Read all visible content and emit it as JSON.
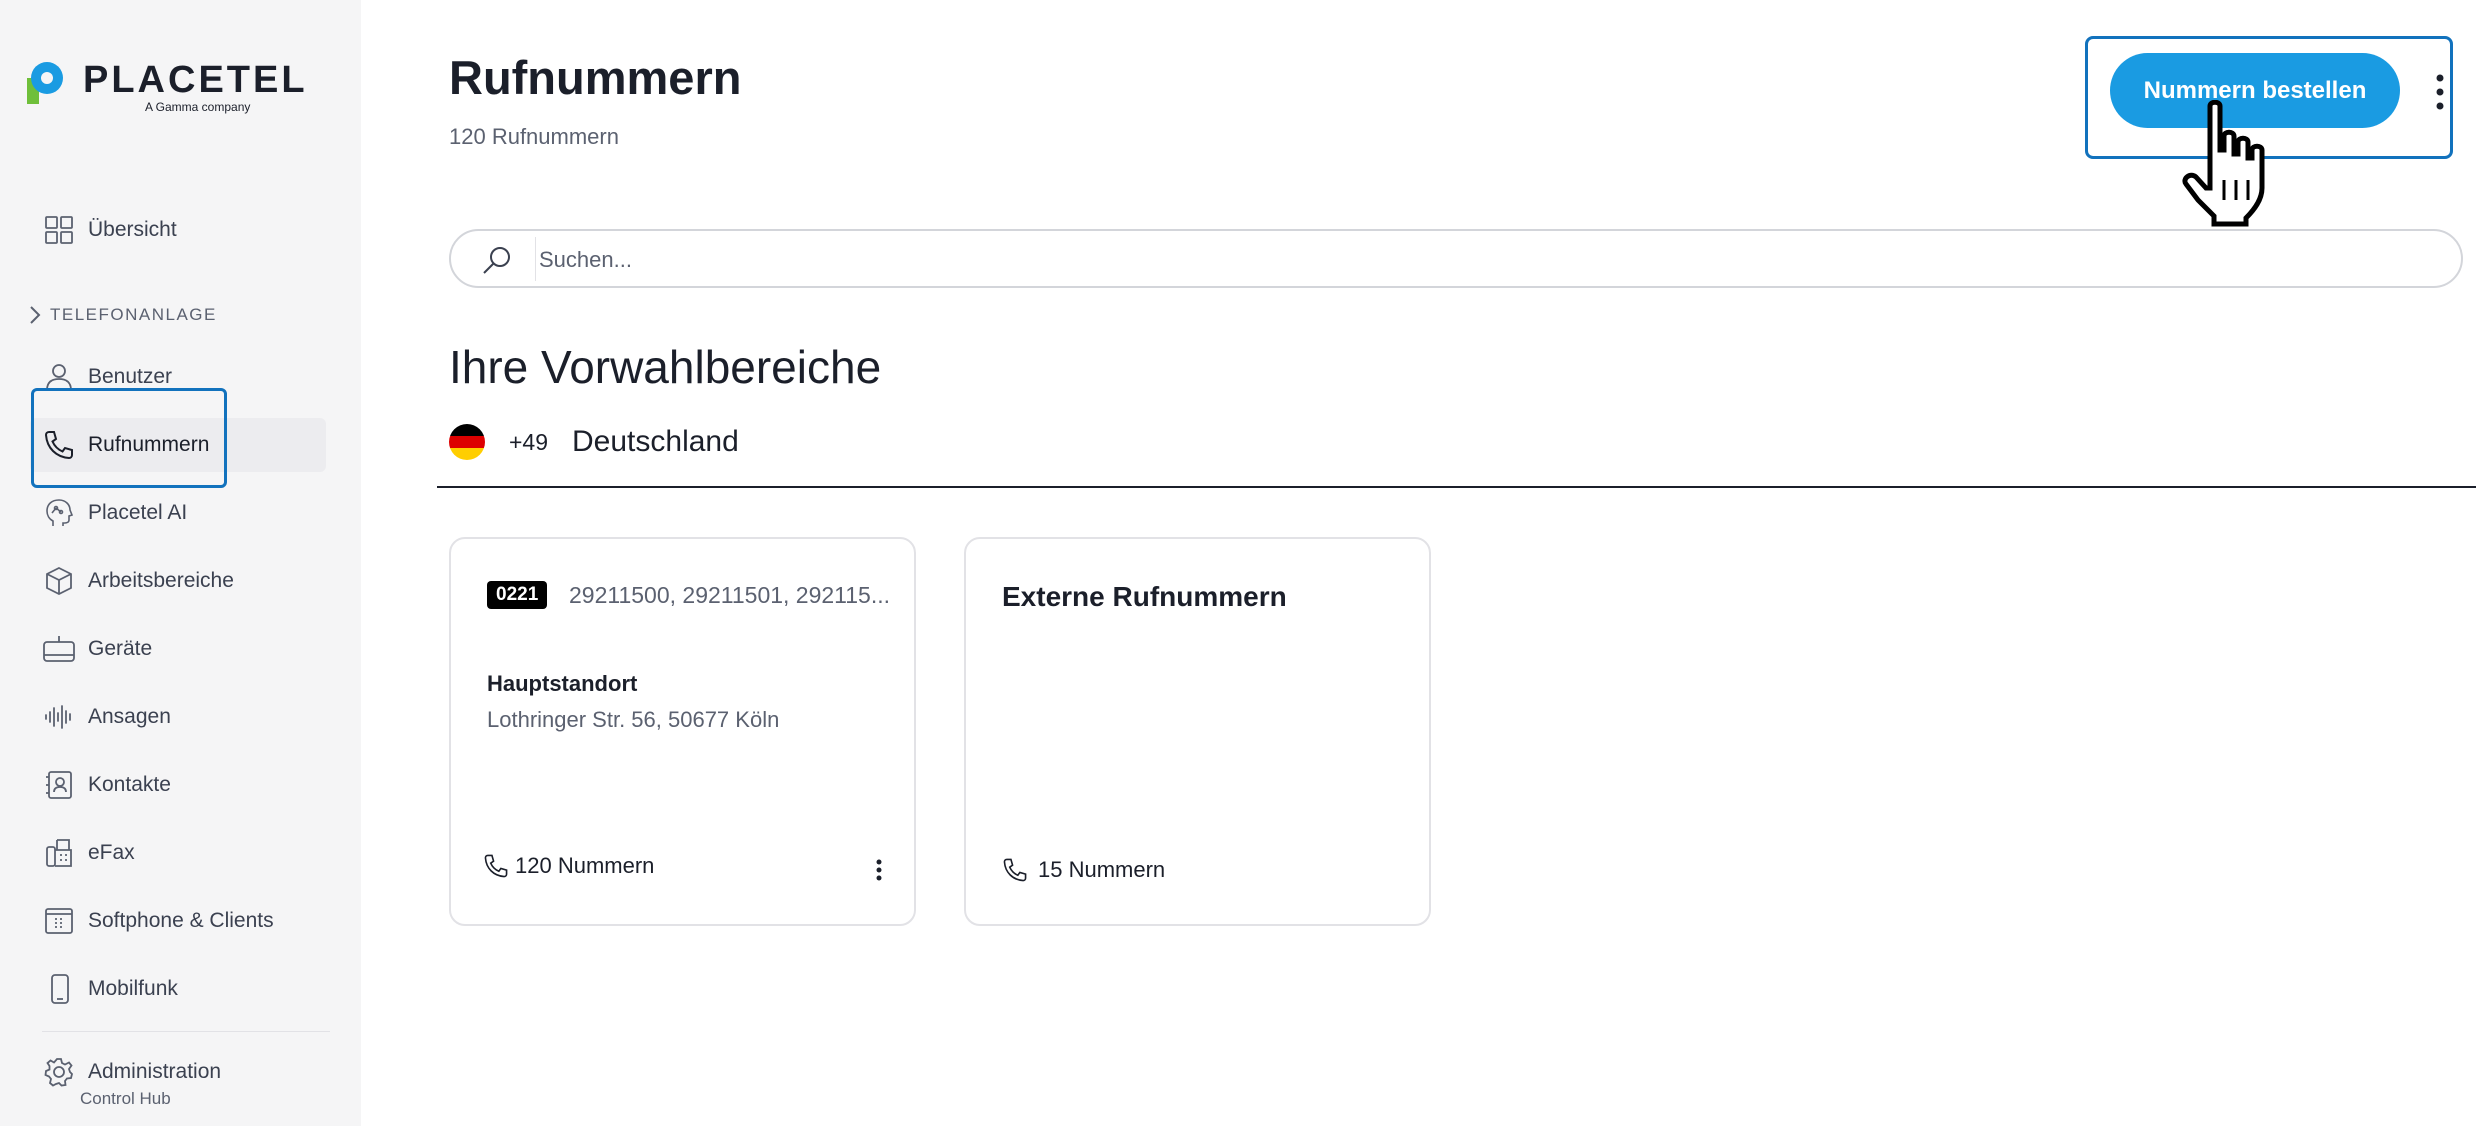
{
  "brand": {
    "name": "PLACETEL",
    "tagline": "A Gamma company",
    "colors": {
      "green": "#6fbf3a",
      "blue": "#1a9be2"
    }
  },
  "sidebar": {
    "overview": {
      "label": "Übersicht",
      "icon": "grid-icon"
    },
    "section_label": "TELEFONANLAGE",
    "items": [
      {
        "label": "Benutzer",
        "icon": "user-icon"
      },
      {
        "label": "Rufnummern",
        "icon": "phone-icon",
        "active": true
      },
      {
        "label": "Placetel AI",
        "icon": "ai-head-icon"
      },
      {
        "label": "Arbeitsbereiche",
        "icon": "cube-icon"
      },
      {
        "label": "Geräte",
        "icon": "device-icon"
      },
      {
        "label": "Ansagen",
        "icon": "audio-wave-icon"
      },
      {
        "label": "Kontakte",
        "icon": "contacts-icon"
      },
      {
        "label": "eFax",
        "icon": "fax-icon"
      },
      {
        "label": "Softphone & Clients",
        "icon": "softphone-icon"
      },
      {
        "label": "Mobilfunk",
        "icon": "mobile-icon"
      }
    ],
    "admin": {
      "label": "Administration",
      "sub": "Control Hub",
      "icon": "gear-icon"
    }
  },
  "header": {
    "title": "Rufnummern",
    "subtitle": "120 Rufnummern",
    "order_button": "Nummern bestellen"
  },
  "search": {
    "placeholder": "Suchen..."
  },
  "areas": {
    "title": "Ihre Vorwahlbereiche",
    "country_code": "+49",
    "country": "Deutschland"
  },
  "cards": [
    {
      "prefix": "0221",
      "numbers": "29211500, 29211501, 292115...",
      "location_name": "Hauptstandort",
      "address": "Lothringer Str. 56, 50677 Köln",
      "count": "120 Nummern"
    },
    {
      "title": "Externe Rufnummern",
      "count": "15 Nummern"
    }
  ]
}
